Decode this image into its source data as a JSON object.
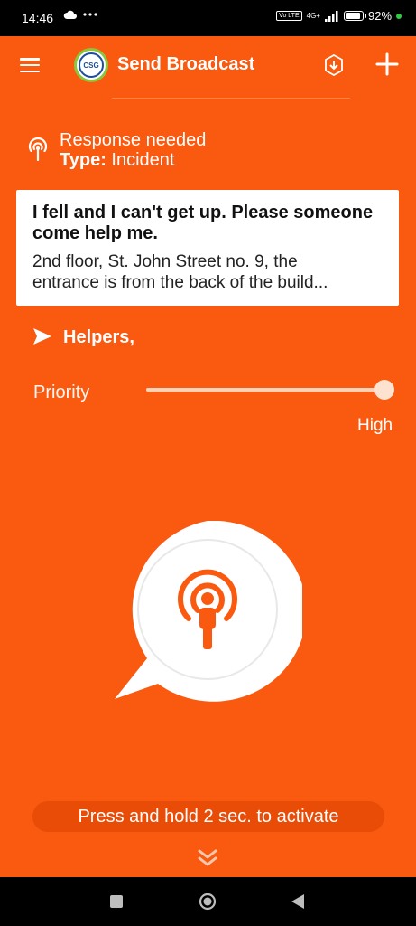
{
  "status_bar": {
    "time": "14:46",
    "left_icons": [
      "cloud-icon",
      "more-dots-icon"
    ],
    "lte_label": "Vo LTE",
    "network_label": "4G+",
    "battery_percent": "92",
    "battery_suffix": "%",
    "battery_level": 0.92
  },
  "app_bar": {
    "logo_text": "CSG",
    "title": "Send Broadcast",
    "icons": [
      "menu-icon",
      "download-icon",
      "add-icon"
    ]
  },
  "response": {
    "title": "Response needed",
    "type_label": "Type:",
    "type_value": "Incident"
  },
  "message": {
    "title": "I fell and I can't get up. Please someone come help me.",
    "body_line1": "2nd floor, St. John Street no. 9, the",
    "body_line2": "entrance is from the back of the build..."
  },
  "helpers": {
    "label": "Helpers,"
  },
  "priority": {
    "label": "Priority",
    "value": "High",
    "level": 1.0
  },
  "activate": {
    "hint": "Press and hold 2 sec. to activate"
  },
  "colors": {
    "background": "#fa5a10",
    "accent": "#fa5a10",
    "hint_bar": "#e84c07",
    "card": "#ffffff"
  }
}
